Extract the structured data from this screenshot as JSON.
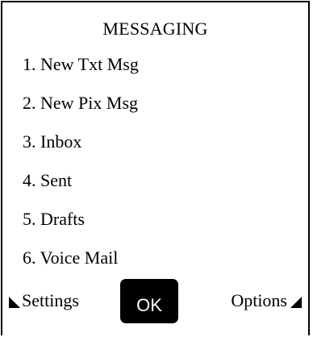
{
  "screen": {
    "title": "MESSAGING"
  },
  "menu": {
    "items": [
      {
        "label": "1. New Txt Msg"
      },
      {
        "label": "2. New Pix Msg"
      },
      {
        "label": "3. Inbox"
      },
      {
        "label": "4. Sent"
      },
      {
        "label": "5. Drafts"
      },
      {
        "label": "6. Voice Mail"
      }
    ]
  },
  "softkeys": {
    "left_label": "Settings",
    "center_label": "OK",
    "right_label": "Options",
    "left_icon": "triangle-down-left-icon",
    "right_icon": "triangle-down-right-icon"
  },
  "colors": {
    "background": "#ffffff",
    "text": "#000000",
    "ok_button_bg": "#000000",
    "ok_button_text": "#ffffff"
  }
}
